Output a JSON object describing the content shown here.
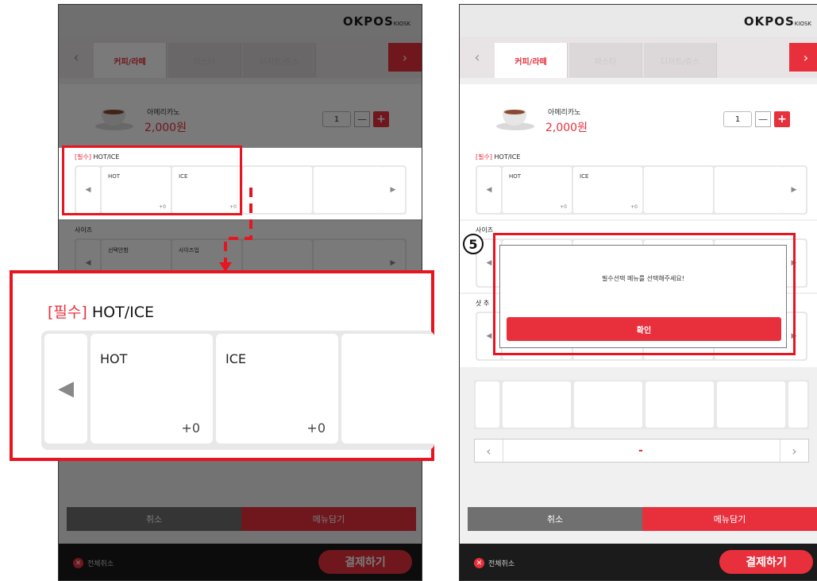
{
  "brand": {
    "logo": "OKPOS",
    "logo_sub": "KIOSK"
  },
  "tabs": [
    {
      "label": "커피/라떼"
    },
    {
      "label": "파스타"
    },
    {
      "label": "디저트/쥬스"
    }
  ],
  "item": {
    "name": "아메리카노",
    "price": "2,000원",
    "qty": "1"
  },
  "options": {
    "hotice": {
      "req": "[필수]",
      "title": "HOT/ICE",
      "cards": [
        {
          "name": "HOT",
          "price": "+0"
        },
        {
          "name": "ICE",
          "price": "+0"
        }
      ]
    },
    "size": {
      "title": "사이즈",
      "cards": [
        {
          "name": "선택안함"
        },
        {
          "name": "사이즈업"
        }
      ]
    },
    "shot": {
      "title": "샷 추"
    }
  },
  "actions": {
    "cancel": "취소",
    "add": "메뉴담기",
    "clear_all": "전체취소",
    "pay": "결제하기"
  },
  "dialog": {
    "message": "필수선택 메뉴를 선택해주세요!",
    "confirm": "확인"
  },
  "step": "5",
  "pager": {
    "middle": "-"
  },
  "colors": {
    "accent": "#e8303d",
    "highlight": "#e8141f"
  },
  "icons": {
    "prev": "◀",
    "next": "▶",
    "tab_prev": "‹",
    "tab_next": "›",
    "pager_prev": "‹",
    "pager_next": "›",
    "close": "✕"
  }
}
